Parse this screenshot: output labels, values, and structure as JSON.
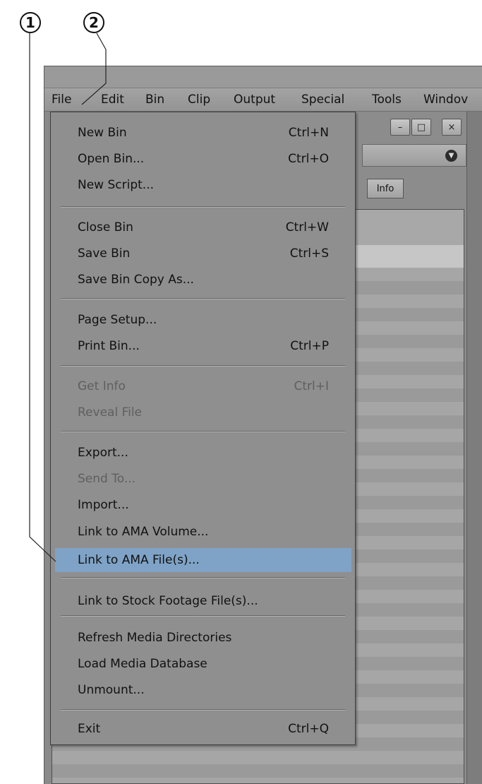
{
  "callouts": {
    "one": "1",
    "two": "2"
  },
  "menubar": {
    "file": "File",
    "edit": "Edit",
    "bin": "Bin",
    "clip": "Clip",
    "output": "Output",
    "special": "Special",
    "tools": "Tools",
    "windows": "Windov"
  },
  "bin_window": {
    "minimize": "–",
    "maximize": "□",
    "close": "×",
    "dropdown": "▼",
    "info_button": "Info"
  },
  "file_menu": {
    "new_bin": {
      "label": "New Bin",
      "shortcut": "Ctrl+N"
    },
    "open_bin": {
      "label": "Open Bin...",
      "shortcut": "Ctrl+O"
    },
    "new_script": {
      "label": "New Script..."
    },
    "close_bin": {
      "label": "Close Bin",
      "shortcut": "Ctrl+W"
    },
    "save_bin": {
      "label": "Save Bin",
      "shortcut": "Ctrl+S"
    },
    "save_bin_copy": {
      "label": "Save Bin Copy As..."
    },
    "page_setup": {
      "label": "Page Setup..."
    },
    "print_bin": {
      "label": "Print Bin...",
      "shortcut": "Ctrl+P"
    },
    "get_info": {
      "label": "Get Info",
      "shortcut": "Ctrl+I"
    },
    "reveal_file": {
      "label": "Reveal File"
    },
    "export": {
      "label": "Export..."
    },
    "send_to": {
      "label": "Send To..."
    },
    "import": {
      "label": "Import..."
    },
    "link_ama_volume": {
      "label": "Link to AMA Volume..."
    },
    "link_ama_files": {
      "label": "Link to AMA File(s)..."
    },
    "link_stock": {
      "label": "Link to Stock Footage File(s)..."
    },
    "refresh_media": {
      "label": "Refresh Media Directories"
    },
    "load_media_db": {
      "label": "Load Media Database"
    },
    "unmount": {
      "label": "Unmount..."
    },
    "exit": {
      "label": "Exit",
      "shortcut": "Ctrl+Q"
    }
  },
  "colors": {
    "highlight": "#7fa3c6",
    "menu_bg": "#8f8f8f",
    "disabled_text": "#5f5f5f"
  }
}
